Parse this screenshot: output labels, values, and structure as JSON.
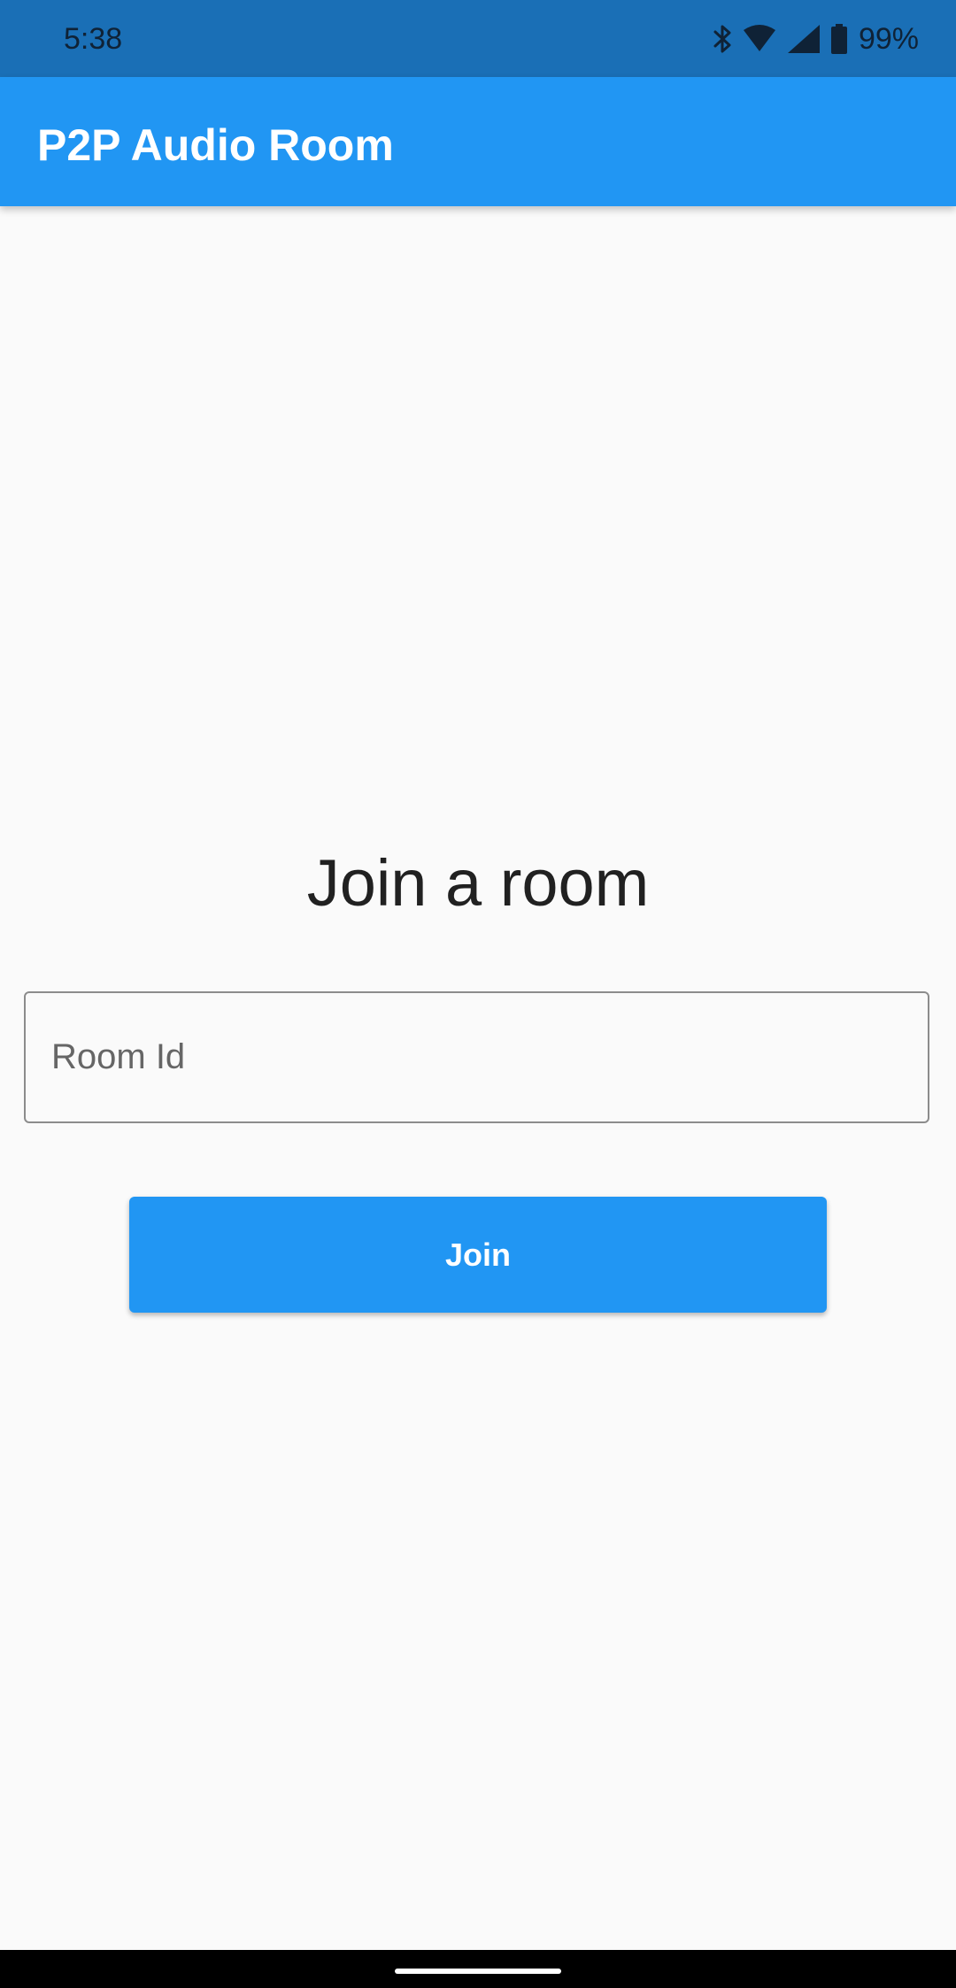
{
  "status_bar": {
    "time": "5:38",
    "battery": "99%",
    "icons": [
      "bluetooth-icon",
      "wifi-icon",
      "cellular-signal-icon",
      "battery-icon"
    ]
  },
  "app_bar": {
    "title": "P2P Audio Room",
    "color": "#2196f3"
  },
  "main": {
    "heading": "Join a room",
    "room_input": {
      "value": "",
      "placeholder": "Room Id"
    },
    "join_button_label": "Join"
  },
  "colors": {
    "status_bar": "#1a6fb6",
    "accent": "#2196f3",
    "background": "#fafafa"
  }
}
